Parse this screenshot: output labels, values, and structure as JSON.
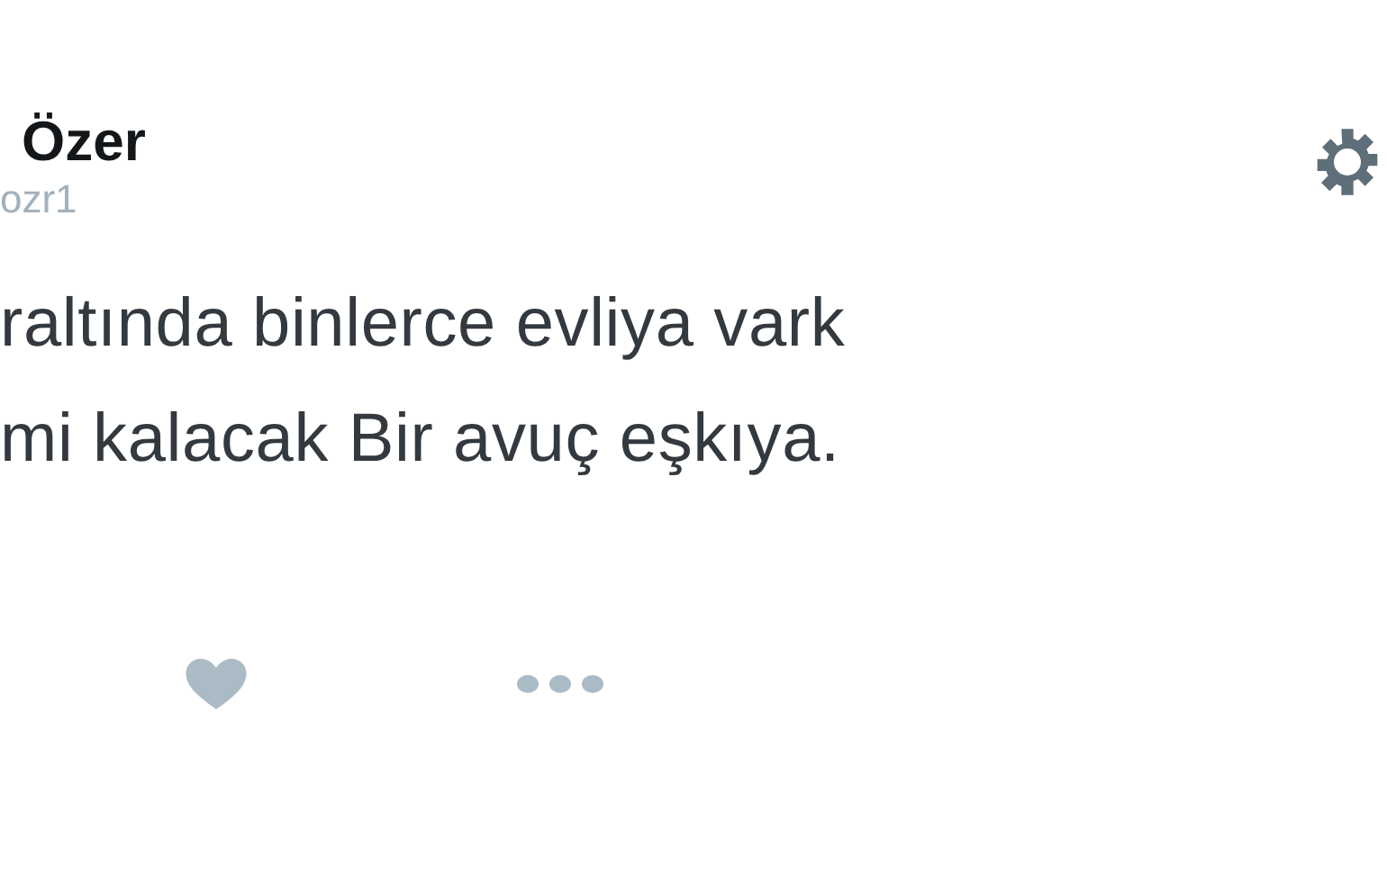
{
  "author": {
    "name": "Özer",
    "handle": "ozr1"
  },
  "tweet": {
    "lines": [
      "raltında binlerce evliya vark",
      "mi kalacak Bir avuç eşkıya."
    ]
  }
}
